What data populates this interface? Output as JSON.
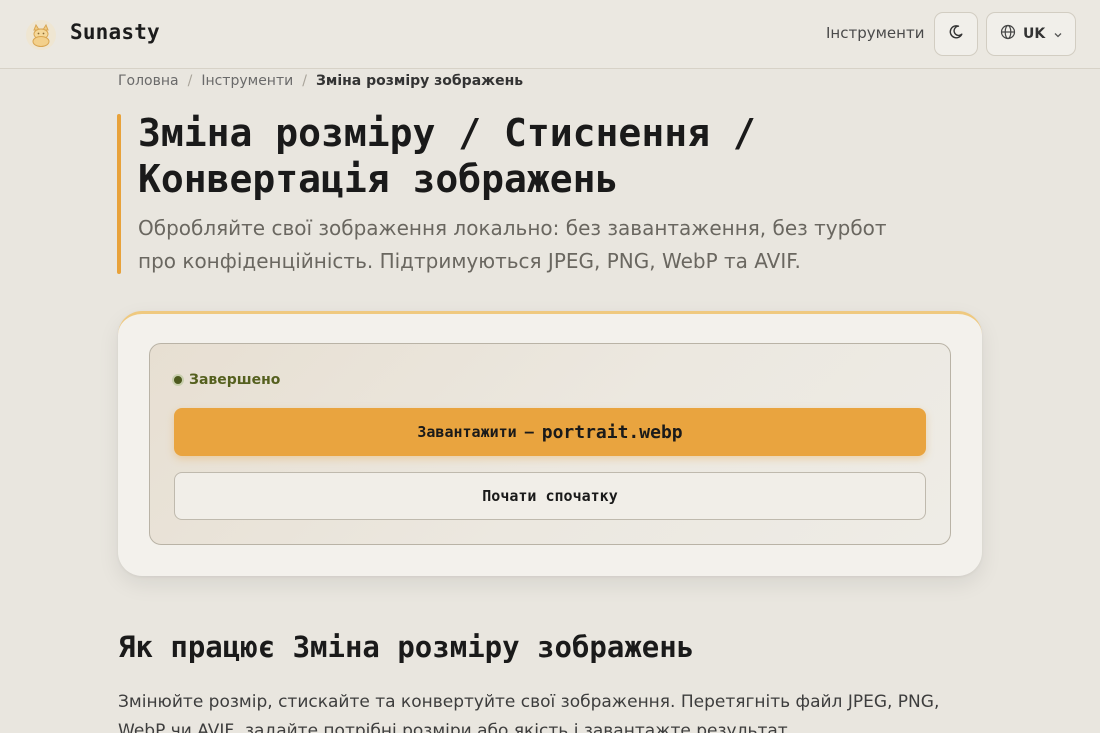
{
  "header": {
    "brand": "Sunasty",
    "nav_tools": "Інструменти",
    "lang_code": "UK"
  },
  "breadcrumb": {
    "items": [
      "Головна",
      "Інструменти"
    ],
    "current": "Зміна розміру зображень",
    "separator": "/"
  },
  "hero": {
    "title": "Зміна розміру / Стиснення / Конвертація зображень",
    "subtitle": "Обробляйте свої зображення локально: без завантаження, без турбот про конфіденційність. Підтримуються JPEG, PNG, WebP та AVIF."
  },
  "tool": {
    "status": "Завершено",
    "download_label": "Завантажити",
    "download_separator": "—",
    "file_name": "portrait.webp",
    "restart_label": "Почати спочатку"
  },
  "section": {
    "title": "Як працює Зміна розміру зображень",
    "text": "Змінюйте розмір, стискайте та конвертуйте свої зображення. Перетягніть файл JPEG, PNG, WebP чи AVIF, задайте потрібні розміри або якість і завантажте результат."
  },
  "colors": {
    "accent": "#e9a43f",
    "background": "#e9e6df",
    "status_green": "#55601f"
  },
  "icons": {
    "logo": "cat-logo-icon",
    "theme": "moon-icon",
    "language": "globe-icon",
    "dropdown": "chevron-down-icon"
  }
}
